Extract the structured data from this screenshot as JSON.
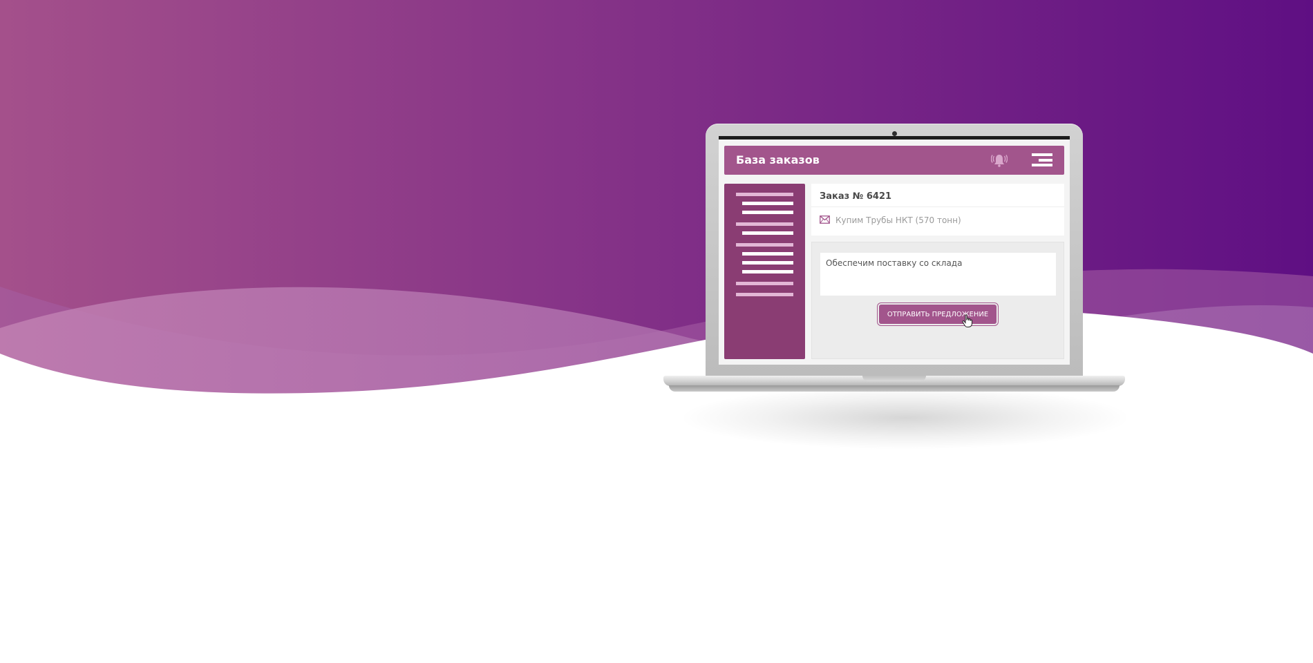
{
  "colors": {
    "accent": "#a2558c",
    "sidebar": "#8a3d73",
    "hero_left": "#a4508b",
    "hero_right": "#5f0f83"
  },
  "app": {
    "title": "База заказов",
    "header_icons": [
      "bell-icon",
      "menu-icon"
    ]
  },
  "order": {
    "title": "Заказ № 6421",
    "subject": "Купим Трубы НКТ (570 тонн)",
    "subject_icon": "mail-icon"
  },
  "reply": {
    "text": "Обеспечим поставку со склада",
    "send_label": "ОТПРАВИТЬ ПРЕДЛОЖЕНИЕ"
  }
}
